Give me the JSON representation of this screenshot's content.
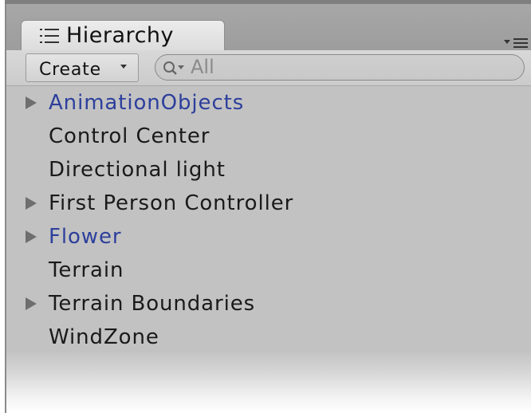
{
  "panel": {
    "tab_title": "Hierarchy",
    "tab_icon": "list-icon",
    "menu_icon": "panel-menu-icon"
  },
  "toolbar": {
    "create_label": "Create",
    "search_placeholder": "All",
    "search_icon": "search-icon"
  },
  "colors": {
    "prefab_text": "#2d3f9c",
    "normal_text": "#1a1a1a",
    "panel_bg": "#c2c2c2"
  },
  "hierarchy": {
    "items": [
      {
        "label": "AnimationObjects",
        "expandable": true,
        "prefab": true
      },
      {
        "label": "Control Center",
        "expandable": false,
        "prefab": false
      },
      {
        "label": "Directional light",
        "expandable": false,
        "prefab": false
      },
      {
        "label": "First Person Controller",
        "expandable": true,
        "prefab": false
      },
      {
        "label": "Flower",
        "expandable": true,
        "prefab": true
      },
      {
        "label": "Terrain",
        "expandable": false,
        "prefab": false
      },
      {
        "label": "Terrain Boundaries",
        "expandable": true,
        "prefab": false
      },
      {
        "label": "WindZone",
        "expandable": false,
        "prefab": false
      }
    ]
  }
}
